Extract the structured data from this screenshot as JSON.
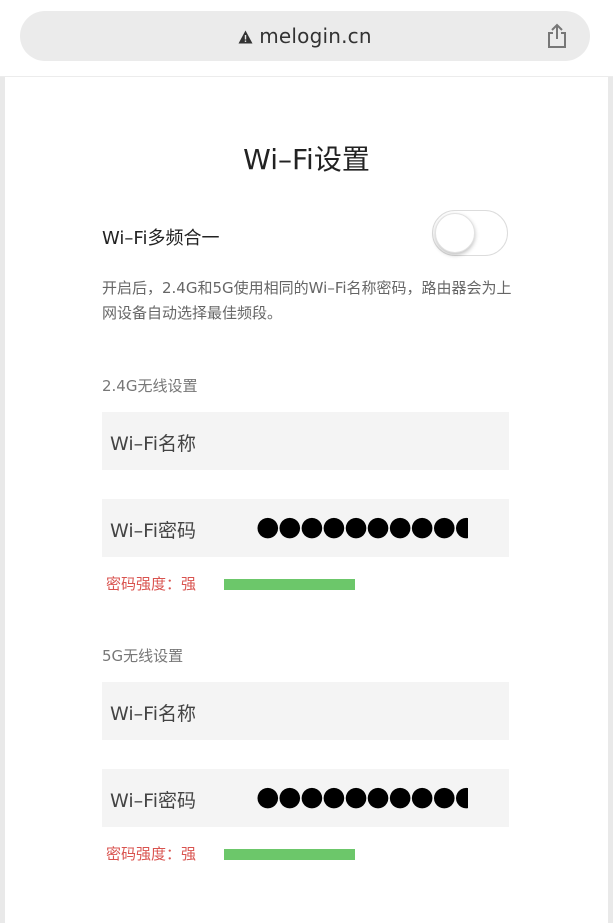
{
  "browser": {
    "url": "melogin.cn"
  },
  "page": {
    "title": "Wi–Fi设置",
    "merge": {
      "label": "Wi–Fi多频合一",
      "enabled": false
    },
    "description": "开启后，2.4G和5G使用相同的Wi–Fi名称密码，路由器会为上网设备自动选择最佳频段。",
    "band_24": {
      "section_label": "2.4G无线设置",
      "name_label": "Wi–Fi名称",
      "name_value": "",
      "password_label": "Wi–Fi密码",
      "password_value": "●●●●●●●●●●●●",
      "strength_text": "密码强度：强",
      "strength_level": 1.0
    },
    "band_5": {
      "section_label": "5G无线设置",
      "name_label": "Wi–Fi名称",
      "name_value": "",
      "password_label": "Wi–Fi密码",
      "password_value": "●●●●●●●●●●●●",
      "strength_text": "密码强度：强",
      "strength_level": 1.0
    }
  },
  "colors": {
    "strength_text": "#d9534f",
    "strength_bar": "#6cc76a",
    "field_bg": "#f4f4f4"
  }
}
